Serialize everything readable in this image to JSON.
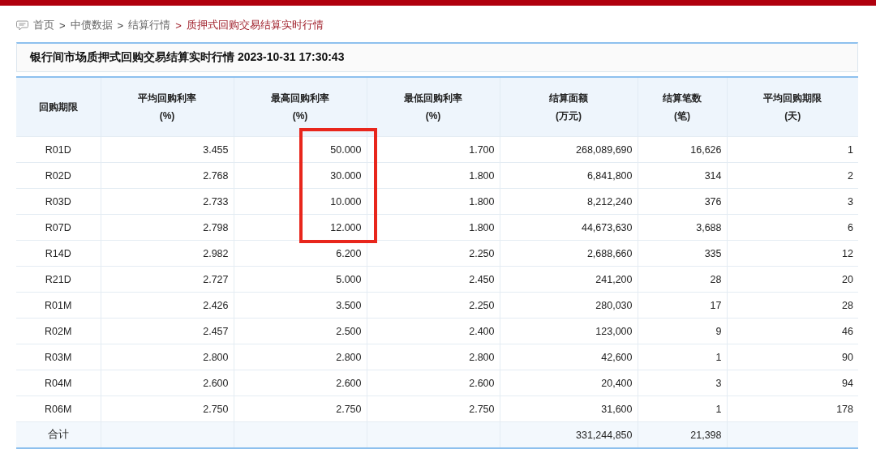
{
  "breadcrumb": [
    {
      "label": "首页",
      "selected": false
    },
    {
      "label": "中债数据",
      "selected": false
    },
    {
      "label": "结算行情",
      "selected": false
    },
    {
      "label": "质押式回购交易结算实时行情",
      "selected": true
    }
  ],
  "separator": ">",
  "title": "银行间市场质押式回购交易结算实时行情 2023-10-31 17:30:43",
  "annotation": {
    "kind": "frame"
  },
  "table": {
    "columns": [
      {
        "title": "回购期限"
      },
      {
        "title": "平均回购利率",
        "unit": "(%)"
      },
      {
        "title": "最高回购利率",
        "unit": "(%)"
      },
      {
        "title": "最低回购利率",
        "unit": "(%)"
      },
      {
        "title": "结算面额",
        "unit": "(万元)"
      },
      {
        "title": "结算笔数",
        "unit": "(笔)"
      },
      {
        "title": "平均回购期限",
        "unit": "(天)"
      }
    ],
    "rows": [
      {
        "cells": [
          "R01D",
          "3.455",
          "50.000",
          "1.700",
          "268,089,690",
          "16,626",
          "1"
        ]
      },
      {
        "cells": [
          "R02D",
          "2.768",
          "30.000",
          "1.800",
          "6,841,800",
          "314",
          "2"
        ]
      },
      {
        "cells": [
          "R03D",
          "2.733",
          "10.000",
          "1.800",
          "8,212,240",
          "376",
          "3"
        ]
      },
      {
        "cells": [
          "R07D",
          "2.798",
          "12.000",
          "1.800",
          "44,673,630",
          "3,688",
          "6"
        ]
      },
      {
        "cells": [
          "R14D",
          "2.982",
          "6.200",
          "2.250",
          "2,688,660",
          "335",
          "12"
        ]
      },
      {
        "cells": [
          "R21D",
          "2.727",
          "5.000",
          "2.450",
          "241,200",
          "28",
          "20"
        ]
      },
      {
        "cells": [
          "R01M",
          "2.426",
          "3.500",
          "2.250",
          "280,030",
          "17",
          "28"
        ]
      },
      {
        "cells": [
          "R02M",
          "2.457",
          "2.500",
          "2.400",
          "123,000",
          "9",
          "46"
        ]
      },
      {
        "cells": [
          "R03M",
          "2.800",
          "2.800",
          "2.800",
          "42,600",
          "1",
          "90"
        ]
      },
      {
        "cells": [
          "R04M",
          "2.600",
          "2.600",
          "2.600",
          "20,400",
          "3",
          "94"
        ]
      },
      {
        "cells": [
          "R06M",
          "2.750",
          "2.750",
          "2.750",
          "31,600",
          "1",
          "178"
        ]
      }
    ],
    "total": {
      "label": "合计",
      "cells": [
        "",
        "",
        "",
        "331,244,850",
        "21,398",
        ""
      ]
    }
  }
}
